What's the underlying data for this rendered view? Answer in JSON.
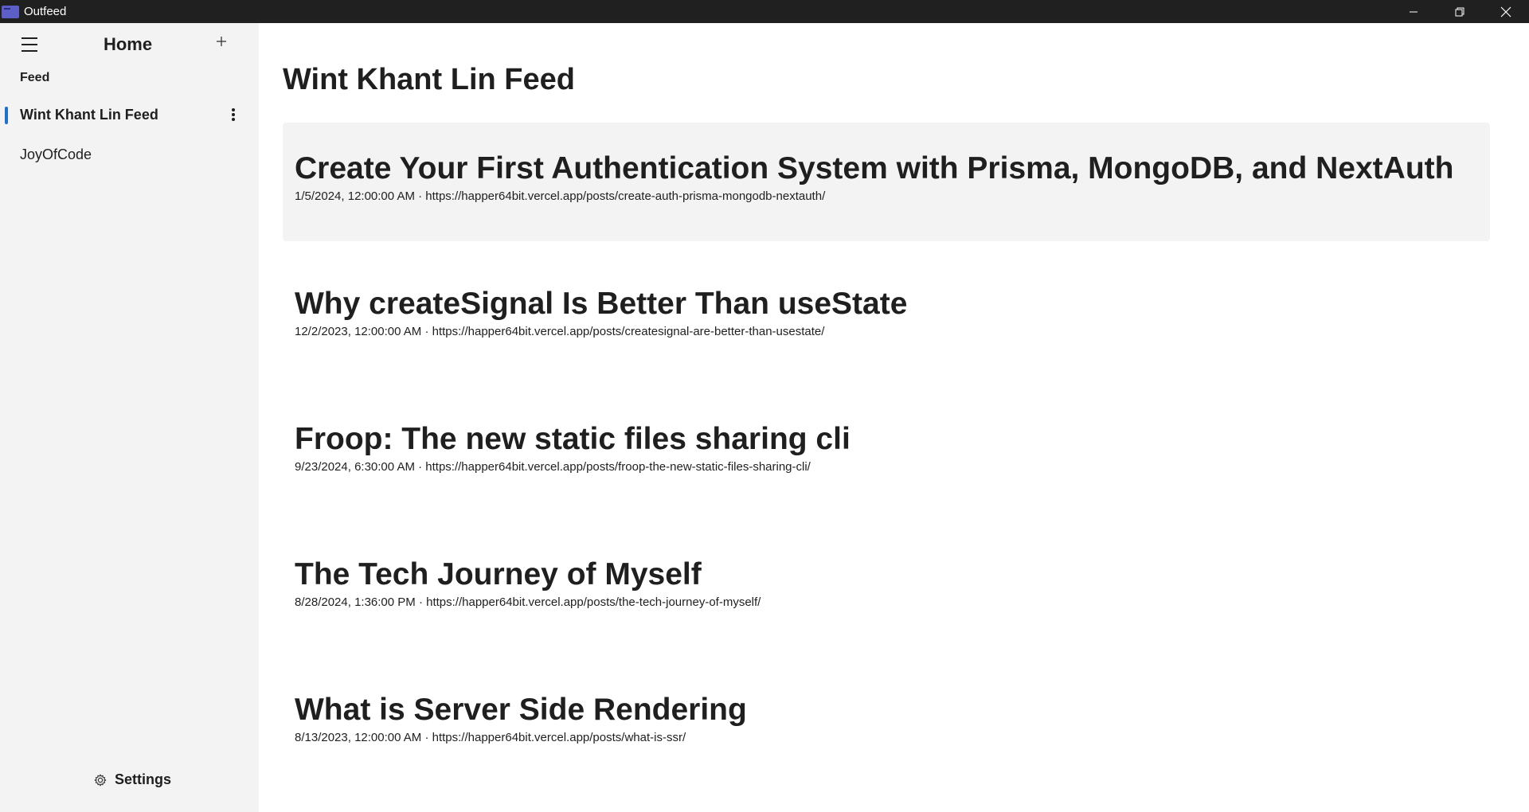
{
  "window": {
    "title": "Outfeed",
    "controls": [
      "minimize-icon",
      "restore-icon",
      "close-icon"
    ]
  },
  "sidebar": {
    "home_label": "Home",
    "add_icon": "plus-icon",
    "menu_icon": "hamburger-icon",
    "section_label": "Feed",
    "items": [
      {
        "label": "Wint Khant Lin Feed",
        "active": true
      },
      {
        "label": "JoyOfCode",
        "active": false
      }
    ],
    "settings_label": "Settings"
  },
  "main": {
    "title": "Wint Khant Lin Feed",
    "posts": [
      {
        "title": "Create Your First Authentication System with Prisma, MongoDB, and NextAuth",
        "meta": "1/5/2024, 12:00:00 AM · https://happer64bit.vercel.app/posts/create-auth-prisma-mongodb-nextauth/"
      },
      {
        "title": "Why createSignal Is Better Than useState",
        "meta": "12/2/2023, 12:00:00 AM · https://happer64bit.vercel.app/posts/createsignal-are-better-than-usestate/"
      },
      {
        "title": "Froop: The new static files sharing cli",
        "meta": "9/23/2024, 6:30:00 AM · https://happer64bit.vercel.app/posts/froop-the-new-static-files-sharing-cli/"
      },
      {
        "title": "The Tech Journey of Myself",
        "meta": "8/28/2024, 1:36:00 PM · https://happer64bit.vercel.app/posts/the-tech-journey-of-myself/"
      },
      {
        "title": "What is Server Side Rendering",
        "meta": "8/13/2023, 12:00:00 AM · https://happer64bit.vercel.app/posts/what-is-ssr/"
      }
    ]
  },
  "colors": {
    "titlebar": "#202020",
    "sidebar_bg": "#f3f3f3",
    "accent": "#1f6fd1",
    "hover_bg": "#f3f3f3"
  }
}
